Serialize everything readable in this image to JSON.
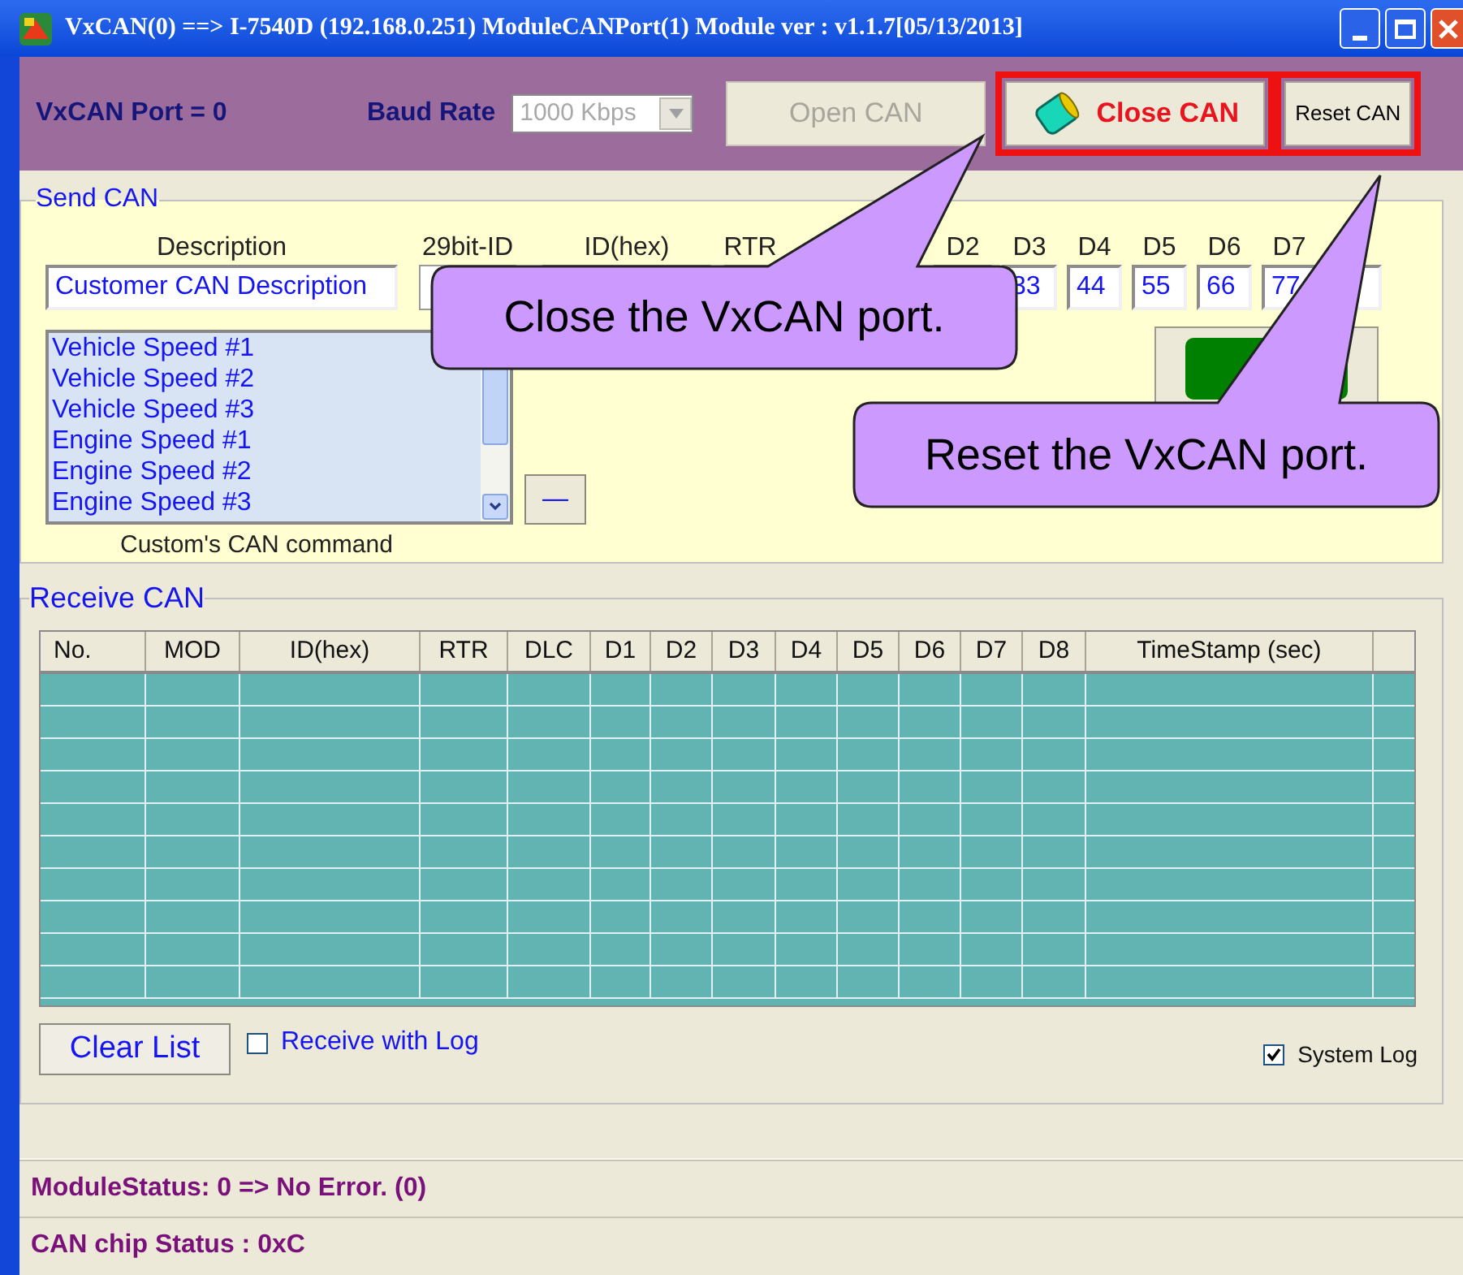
{
  "window": {
    "title": "VxCAN(0) ==> I-7540D (192.168.0.251) ModuleCANPort(1) Module ver : v1.1.7[05/13/2013]"
  },
  "toolbar": {
    "port_label": "VxCAN Port = 0",
    "baud_label": "Baud Rate",
    "baud_select": {
      "value": "1000 Kbps",
      "disabled": true
    },
    "buttons": [
      {
        "label": "Open CAN",
        "kind": "plain",
        "disabled": true,
        "highlighted": false
      },
      {
        "label": "Close CAN",
        "kind": "icon",
        "disabled": false,
        "highlighted": true
      },
      {
        "label": "Reset CAN",
        "kind": "small",
        "disabled": false,
        "highlighted": true
      }
    ]
  },
  "send_can": {
    "title": "Send CAN",
    "fields": [
      {
        "label": "Description",
        "kind": "text",
        "value": "Customer CAN Description"
      },
      {
        "label": "29bit-ID",
        "kind": "checkbox"
      },
      {
        "label": "ID(hex)",
        "kind": "text"
      },
      {
        "label": "RTR",
        "kind": "text"
      },
      {
        "kind": "text"
      },
      {
        "kind": "text"
      },
      {
        "label": "D2",
        "kind": "text"
      },
      {
        "label": "D3",
        "kind": "text",
        "value": "33"
      },
      {
        "label": "D4",
        "kind": "text",
        "value": "44"
      },
      {
        "label": "D5",
        "kind": "text",
        "value": "55"
      },
      {
        "label": "D6",
        "kind": "text",
        "value": "66"
      },
      {
        "label": "D7",
        "kind": "text",
        "value": "77"
      },
      {
        "kind": "text"
      }
    ],
    "commands": [
      "Vehicle Speed #1",
      "Vehicle Speed #2",
      "Vehicle Speed #3",
      "Engine Speed #1",
      "Engine Speed #2",
      "Engine Speed #3"
    ],
    "remove_button": "—",
    "list_caption": "Custom's CAN command"
  },
  "receive_can": {
    "title": "Receive CAN",
    "table": {
      "columns": [
        "No.",
        "MOD",
        "ID(hex)",
        "RTR",
        "DLC",
        "D1",
        "D2",
        "D3",
        "D4",
        "D5",
        "D6",
        "D7",
        "D8",
        "TimeStamp (sec)"
      ]
    },
    "clear_button": "Clear List",
    "receive_with_log": {
      "label": "Receive with Log",
      "checked": false
    },
    "system_log": {
      "label": "System Log",
      "checked": true
    }
  },
  "status": [
    "ModuleStatus: 0 => No Error. (0)",
    "CAN chip Status : 0xC"
  ],
  "callouts": [
    {
      "text": "Close the VxCAN port."
    },
    {
      "text": "Reset the VxCAN port."
    }
  ]
}
